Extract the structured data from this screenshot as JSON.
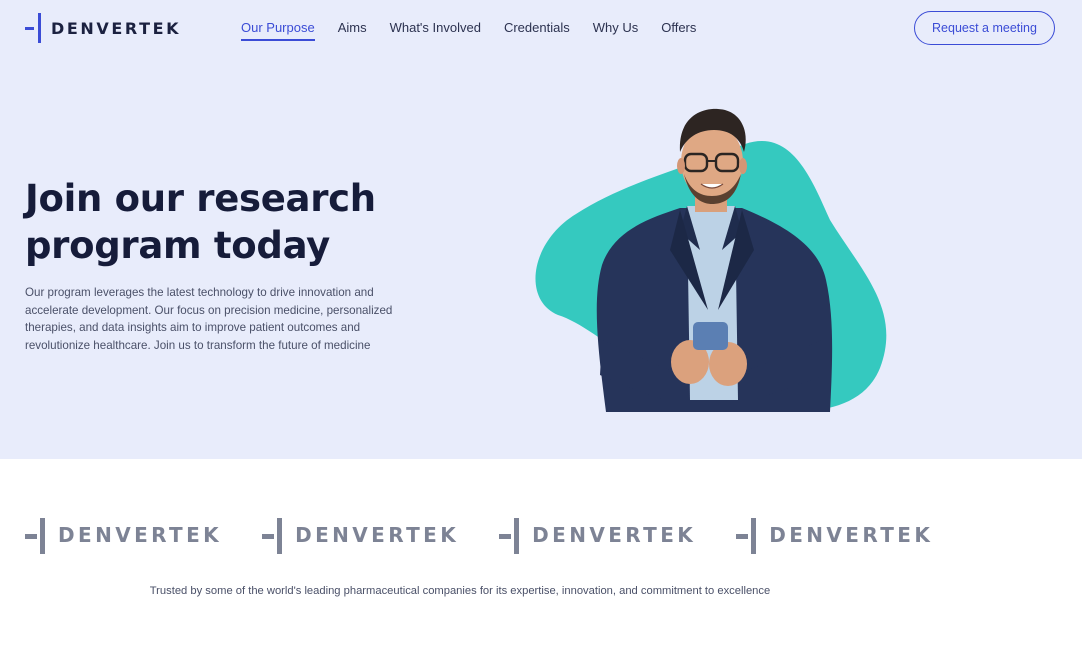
{
  "brand": {
    "name": "DENVERTEK",
    "accent_color": "#3b4cd6"
  },
  "nav": {
    "items": [
      {
        "label": "Our Purpose",
        "active": true
      },
      {
        "label": "Aims"
      },
      {
        "label": "What's Involved"
      },
      {
        "label": "Credentials"
      },
      {
        "label": "Why Us"
      },
      {
        "label": "Offers"
      }
    ],
    "cta_label": "Request a meeting"
  },
  "hero": {
    "headline": "Join our research program today",
    "body": "Our program leverages the latest technology to drive innovation and accelerate development. Our focus on precision medicine, personalized therapies, and data insights aim to improve patient outcomes and revolutionize healthcare. Join us to transform the future of medicine",
    "blob_color": "#35c9bf",
    "background_color": "#e8ecfb"
  },
  "trusted": {
    "partners": [
      "DENVERTEK",
      "DENVERTEK",
      "DENVERTEK",
      "DENVERTEK"
    ],
    "caption": "Trusted by some of the world's leading pharmaceutical companies for its expertise, innovation, and commitment to excellence"
  }
}
